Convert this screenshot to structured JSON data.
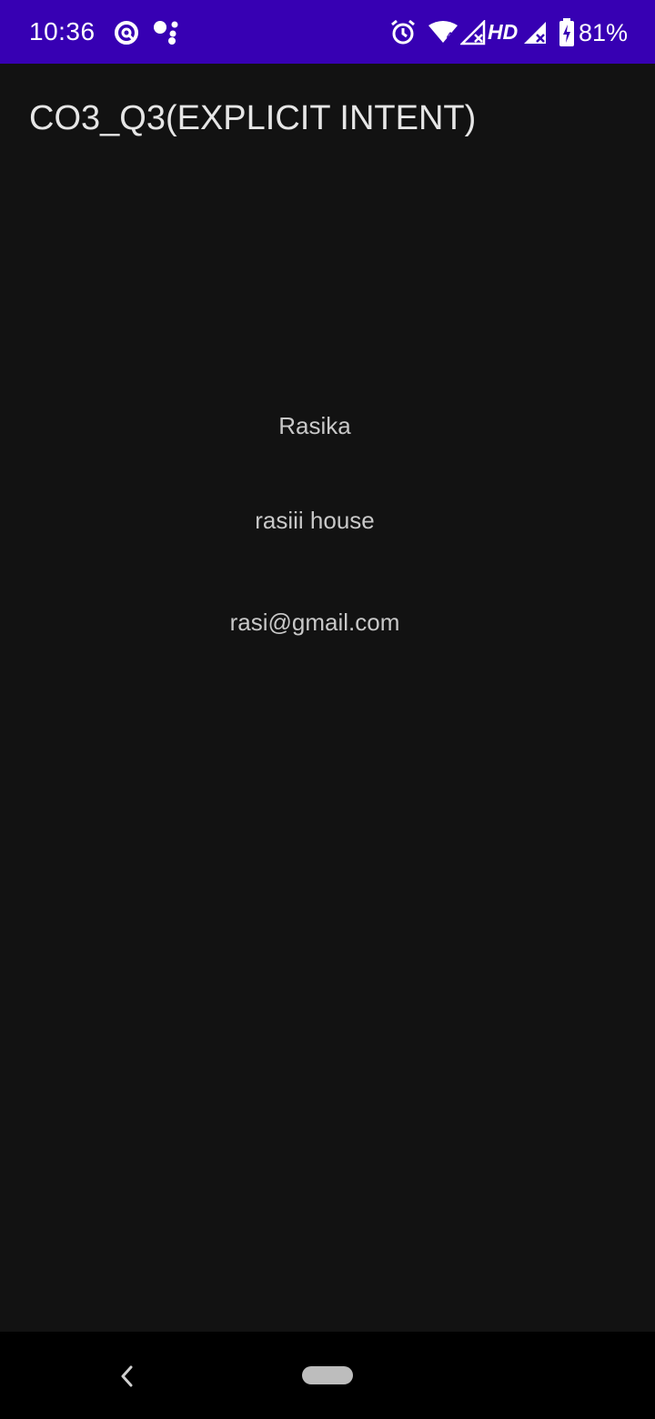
{
  "status_bar": {
    "time": "10:36",
    "network_label": "HD",
    "wifi_badge": "4",
    "battery_percent": "81%",
    "background_color": "#3700b3",
    "icons": [
      "data-saver-icon",
      "assistant-dots-icon",
      "alarm-icon",
      "wifi-icon",
      "signal-icon",
      "signal-icon-2",
      "battery-charging-icon"
    ]
  },
  "app_bar": {
    "title": "CO3_Q3(EXPLICIT INTENT)"
  },
  "content": {
    "name": "Rasika",
    "address": "rasiii house",
    "email": "rasi@gmail.com"
  },
  "nav_bar": {
    "icons": [
      "back-icon",
      "home-pill-icon"
    ]
  }
}
